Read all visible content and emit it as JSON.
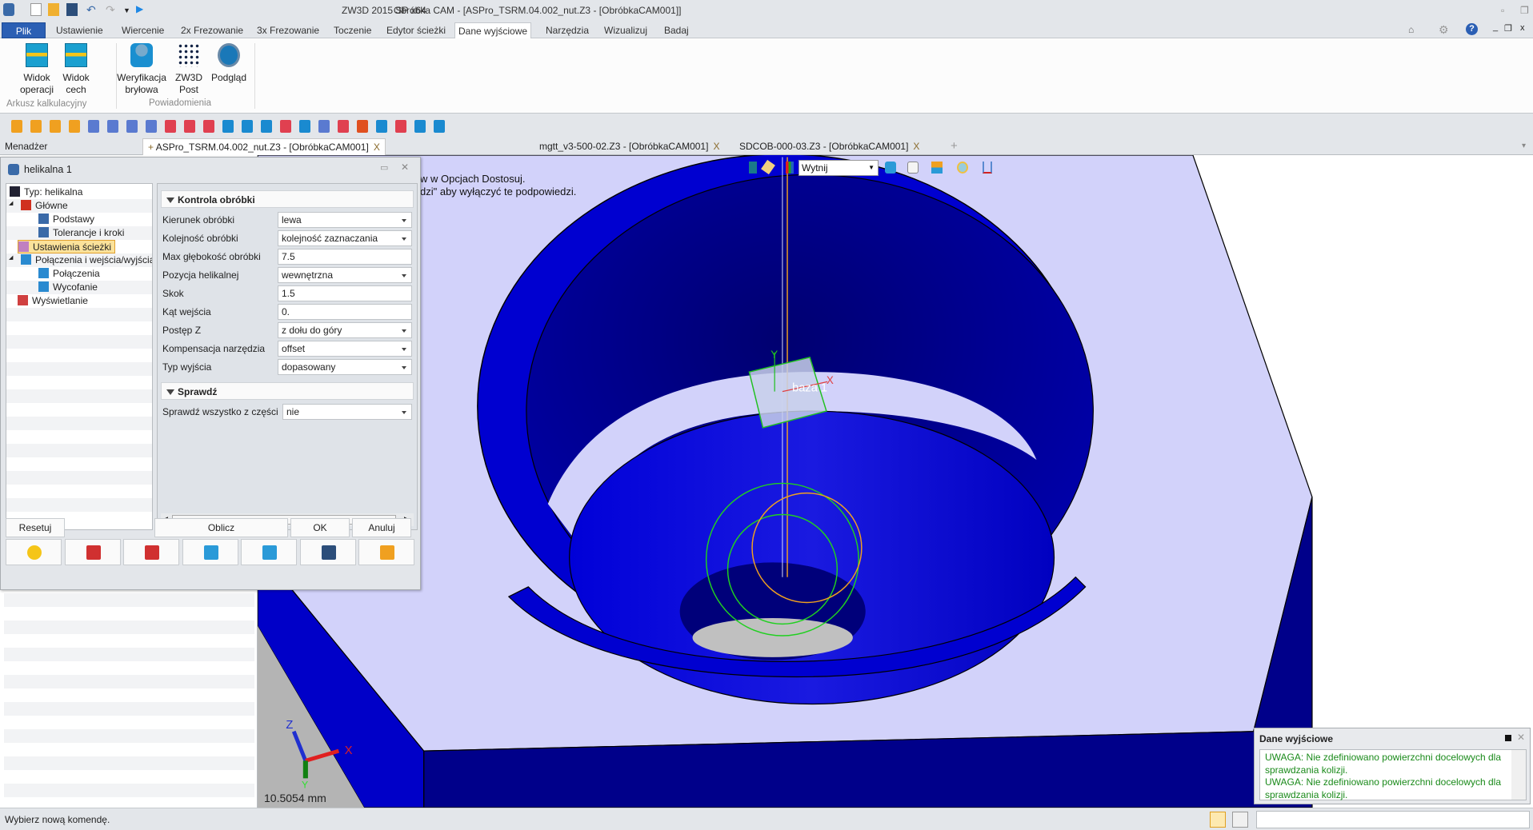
{
  "app": {
    "product": "ZW3D 2015 SP x64",
    "window_title": "Obróbka CAM - [ASPro_TSRM.04.002_nut.Z3 - [ObróbkaCAM001]]"
  },
  "ribbon": {
    "tabs": [
      {
        "label": "Plik"
      },
      {
        "label": "Ustawienie"
      },
      {
        "label": "Wiercenie"
      },
      {
        "label": "2x Frezowanie"
      },
      {
        "label": "3x Frezowanie"
      },
      {
        "label": "Toczenie"
      },
      {
        "label": "Edytor ścieżki"
      },
      {
        "label": "Dane wyjściowe",
        "active": true
      },
      {
        "label": "Narzędzia"
      },
      {
        "label": "Wizualizuj"
      },
      {
        "label": "Badaj"
      }
    ],
    "groups": [
      {
        "label": "Arkusz kalkulacyjny",
        "buttons": [
          {
            "line1": "Widok",
            "line2": "operacji",
            "icon": "spreadsheet-icon"
          },
          {
            "line1": "Widok",
            "line2": "cech",
            "icon": "spreadsheet-icon"
          }
        ]
      },
      {
        "label": "Powiadomienia",
        "buttons": [
          {
            "line1": "Weryfikacja",
            "line2": "bryłowa",
            "icon": "solid-verify-icon"
          },
          {
            "line1": "ZW3D",
            "line2": "Post",
            "icon": "post-icon"
          },
          {
            "line1": "Podgląd",
            "line2": "",
            "icon": "preview-magnifier-icon"
          }
        ]
      }
    ]
  },
  "doc_tabs": {
    "manager_label": "Menadżer",
    "tabs": [
      {
        "label": "ASPro_TSRM.04.002_nut.Z3 - [ObróbkaCAM001]",
        "active": true
      },
      {
        "label": "mgtt_v3-500-02.Z3 - [ObróbkaCAM001]"
      },
      {
        "label": "SDCOB-000-03.Z3 - [ObróbkaCAM001]"
      }
    ],
    "close_glyph": "X",
    "new_tab_glyph": "+"
  },
  "dialog": {
    "title": "helikalna 1",
    "tree": [
      {
        "label": "Typ: helikalna",
        "icon": "type-icon"
      },
      {
        "label": "Główne",
        "icon": "main-icon"
      },
      {
        "label": "Podstawy",
        "icon": "tool-icon"
      },
      {
        "label": "Tolerancje i kroki",
        "icon": "tolerance-icon"
      },
      {
        "label": "Ustawienia ścieżki",
        "icon": "path-settings-icon",
        "selected": true
      },
      {
        "label": "Połączenia i wejścia/wyjścia",
        "icon": "connections-icon"
      },
      {
        "label": "Połączenia",
        "icon": "link-icon"
      },
      {
        "label": "Wycofanie",
        "icon": "retract-icon"
      },
      {
        "label": "Wyświetlanie",
        "icon": "display-icon"
      }
    ],
    "sections": {
      "control": {
        "title": "Kontrola obróbki",
        "rows": [
          {
            "label": "Kierunek obróbki",
            "value": "lewa",
            "dropdown": true
          },
          {
            "label": "Kolejność obróbki",
            "value": "kolejność zaznaczania",
            "dropdown": true
          },
          {
            "label": "Max głębokość obróbki",
            "value": "7.5"
          },
          {
            "label": "Pozycja helikalnej",
            "value": "wewnętrzna",
            "dropdown": true
          },
          {
            "label": "Skok",
            "value": "1.5"
          },
          {
            "label": "Kąt wejścia",
            "value": "0."
          },
          {
            "label": "Postęp Z",
            "value": "z dołu do góry",
            "dropdown": true
          },
          {
            "label": "Kompensacja narzędzia",
            "value": "offset",
            "dropdown": true
          },
          {
            "label": "Typ wyjścia",
            "value": "dopasowany",
            "dropdown": true
          }
        ]
      },
      "check": {
        "title": "Sprawdź",
        "rows": [
          {
            "label": "Sprawdź wszystko z części",
            "value": "nie",
            "dropdown": true
          }
        ]
      }
    },
    "buttons": {
      "reset": "Resetuj",
      "calculate": "Oblicz",
      "ok": "OK",
      "cancel": "Anuluj"
    },
    "icon_buttons": [
      "lightbulb-icon",
      "edit-icon",
      "toolpath-icon",
      "verify-icon",
      "tools-icon",
      "save-icon",
      "open-folder-icon"
    ]
  },
  "viewport": {
    "hint_line1": "w w Opcjach Dostosuj.",
    "hint_line2": "dzi\" aby wyłączyć te podpowiedzi.",
    "filter_value": "Wytnij",
    "datum_label": "baza 1",
    "axis_x": "X",
    "axis_y": "Y",
    "axis_z": "Z",
    "scale_readout": "10.5054 mm"
  },
  "output_panel": {
    "title": "Dane wyjściowe",
    "messages": [
      "UWAGA: Nie zdefiniowano powierzchni docelowych dla sprawdzania kolizji.",
      "UWAGA: Nie zdefiniowano powierzchni docelowych dla sprawdzania kolizji."
    ]
  },
  "status_bar": {
    "prompt": "Wybierz nową komendę."
  },
  "colors": {
    "accent": "#2b5fb4",
    "part_blue": "#0000d0",
    "part_face": "#d2d2fa",
    "warning_text": "#1a8a1a",
    "selection": "#fbe29a"
  }
}
